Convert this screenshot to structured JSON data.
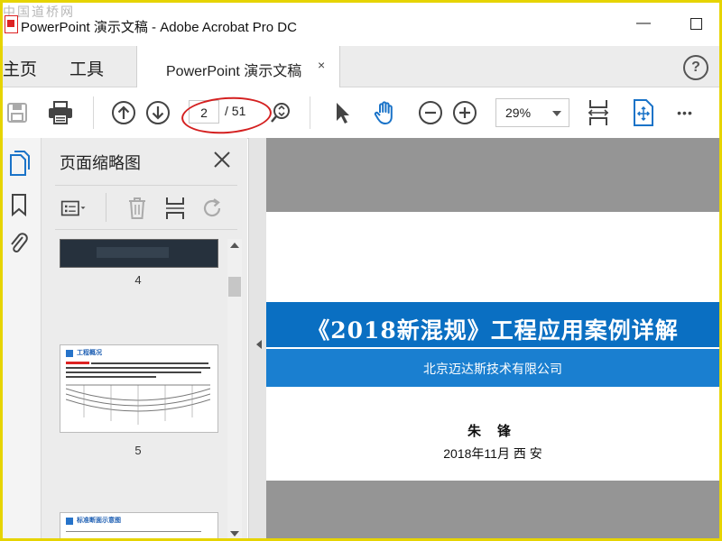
{
  "window": {
    "title": "PowerPoint 演示文稿 - Adobe Acrobat Pro DC",
    "watermark": "中国道桥网",
    "minimize_label": "—"
  },
  "nav": {
    "home": "主页",
    "tools": "工具",
    "doc_tab": "PowerPoint 演示文稿",
    "doc_tab_close": "×",
    "help": "?"
  },
  "toolbar": {
    "current_page": "2",
    "total_pages": "/ 51",
    "zoom": "29%",
    "more": "•••"
  },
  "thumbnail_panel": {
    "title": "页面缩略图",
    "thumbnails": [
      {
        "page": "4"
      },
      {
        "page": "5",
        "heading": "工程概况"
      },
      {
        "page": "",
        "heading": "标准断面示意图"
      }
    ]
  },
  "document": {
    "title": "《2018新混规》工程应用案例详解",
    "company": "北京迈达斯技术有限公司",
    "author": "朱锋",
    "date": "2018年11月  西 安"
  },
  "colors": {
    "banner": "#0a6fc2",
    "subbanner": "#1a7fd0",
    "annotation": "#d42020",
    "accent_blue": "#1a73c8"
  }
}
